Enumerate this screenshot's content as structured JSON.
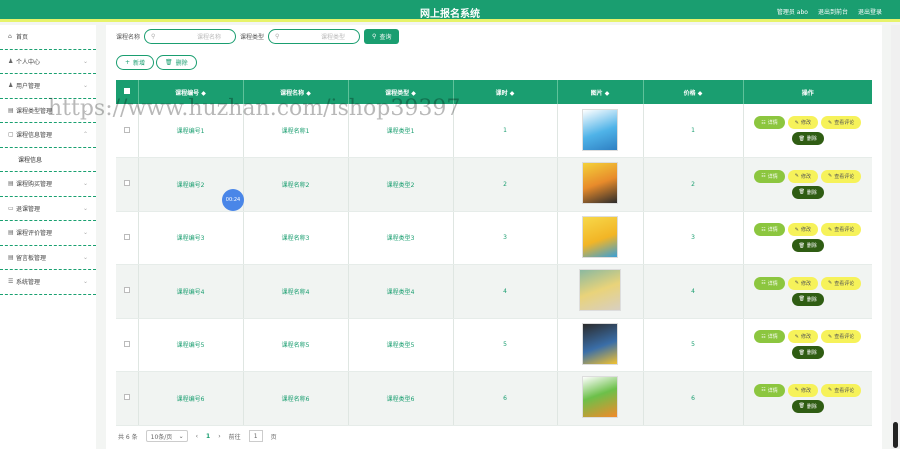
{
  "header": {
    "title": "网上报名系统",
    "user": "管理员 abo",
    "back_home": "退出到前台",
    "logout": "退出登录"
  },
  "sidebar": {
    "items": [
      {
        "icon": "home-icon",
        "glyph": "⌂",
        "label": "首页"
      },
      {
        "icon": "user-icon",
        "glyph": "♟",
        "label": "个人中心"
      },
      {
        "icon": "users-icon",
        "glyph": "♟",
        "label": "用户管理"
      },
      {
        "icon": "list-icon",
        "glyph": "▤",
        "label": "课程类型管理"
      },
      {
        "icon": "doc-icon",
        "glyph": "▢",
        "label": "课程信息管理"
      },
      {
        "icon": "sub",
        "glyph": "",
        "label": "课程信息"
      },
      {
        "icon": "cart-icon",
        "glyph": "▤",
        "label": "课程购买管理"
      },
      {
        "icon": "refund-icon",
        "glyph": "▭",
        "label": "退课管理"
      },
      {
        "icon": "rating-icon",
        "glyph": "▤",
        "label": "课程评价管理"
      },
      {
        "icon": "lock-icon",
        "glyph": "▤",
        "label": "留言板管理"
      },
      {
        "icon": "settings-icon",
        "glyph": "☰",
        "label": "系统管理"
      }
    ]
  },
  "search": {
    "name_label": "课程名称",
    "name_placeholder": "课程名称",
    "type_label": "课程类型",
    "type_placeholder": "课程类型",
    "button": "查询"
  },
  "actions": {
    "add": "新增",
    "delete": "删除"
  },
  "table": {
    "headers": [
      "课程编号 ◆",
      "课程名称 ◆",
      "课程类型 ◆",
      "课时 ◆",
      "图片 ◆",
      "价格 ◆",
      "操作"
    ],
    "rows": [
      {
        "code": "课程编号1",
        "name": "课程名称1",
        "type": "课程类型1",
        "hours": "1",
        "price": "1"
      },
      {
        "code": "课程编号2",
        "name": "课程名称2",
        "type": "课程类型2",
        "hours": "2",
        "price": "2"
      },
      {
        "code": "课程编号3",
        "name": "课程名称3",
        "type": "课程类型3",
        "hours": "3",
        "price": "3"
      },
      {
        "code": "课程编号4",
        "name": "课程名称4",
        "type": "课程类型4",
        "hours": "4",
        "price": "4"
      },
      {
        "code": "课程编号5",
        "name": "课程名称5",
        "type": "课程类型5",
        "hours": "5",
        "price": "5"
      },
      {
        "code": "课程编号6",
        "name": "课程名称6",
        "type": "课程类型6",
        "hours": "6",
        "price": "6"
      }
    ],
    "ops": {
      "detail": "详情",
      "edit": "修改",
      "review": "查看评论",
      "delete": "删除"
    }
  },
  "pagination": {
    "total": "共 6 条",
    "page_size": "10条/页",
    "current": "1",
    "goto": "前往",
    "goto_value": "1",
    "page_unit": "页"
  },
  "watermark": "https://www.huzhan.com/ishop39397",
  "badge": "00:24",
  "colors": {
    "primary": "#1a9e70",
    "accent_yellow": "#e7f36a",
    "detail": "#8cc63f",
    "delete": "#2f5d13"
  }
}
